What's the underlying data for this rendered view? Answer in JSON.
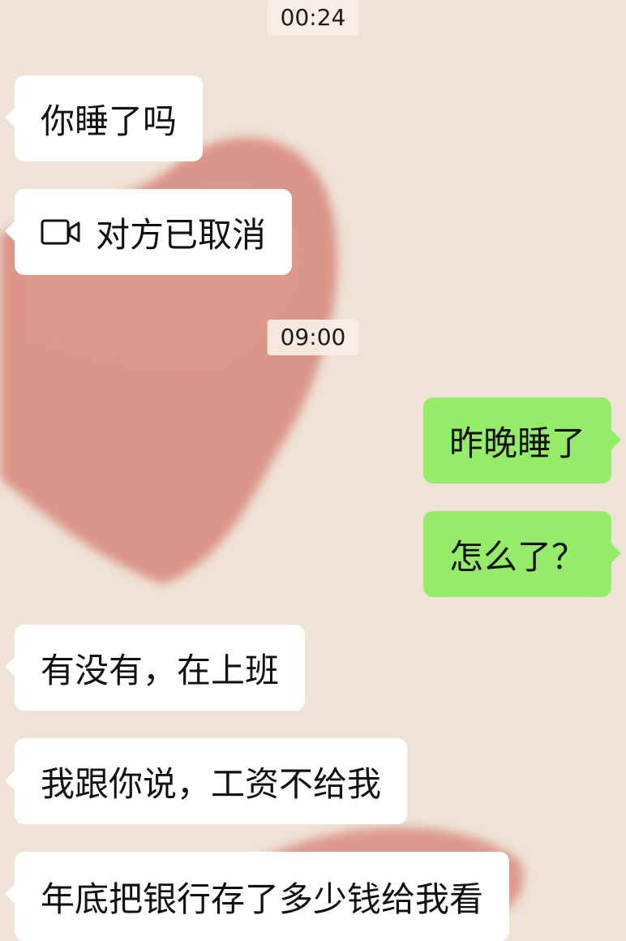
{
  "chat": {
    "messages": [
      {
        "type": "timestamp",
        "text": "00:24"
      },
      {
        "type": "received",
        "text": "你睡了吗"
      },
      {
        "type": "received",
        "icon": "video-call-icon",
        "text": "对方已取消"
      },
      {
        "type": "timestamp",
        "text": "09:00"
      },
      {
        "type": "sent",
        "text": "昨晚睡了"
      },
      {
        "type": "sent",
        "text": "怎么了？"
      },
      {
        "type": "received",
        "text": "有没有，在上班"
      },
      {
        "type": "received",
        "text": "我跟你说，工资不给我"
      },
      {
        "type": "received",
        "text": "年底把银行存了多少钱给我看"
      }
    ]
  },
  "colors": {
    "background": "#efe2d6",
    "heart": "#d98c80",
    "sent_bubble": "#95ec69",
    "received_bubble": "#ffffff"
  }
}
